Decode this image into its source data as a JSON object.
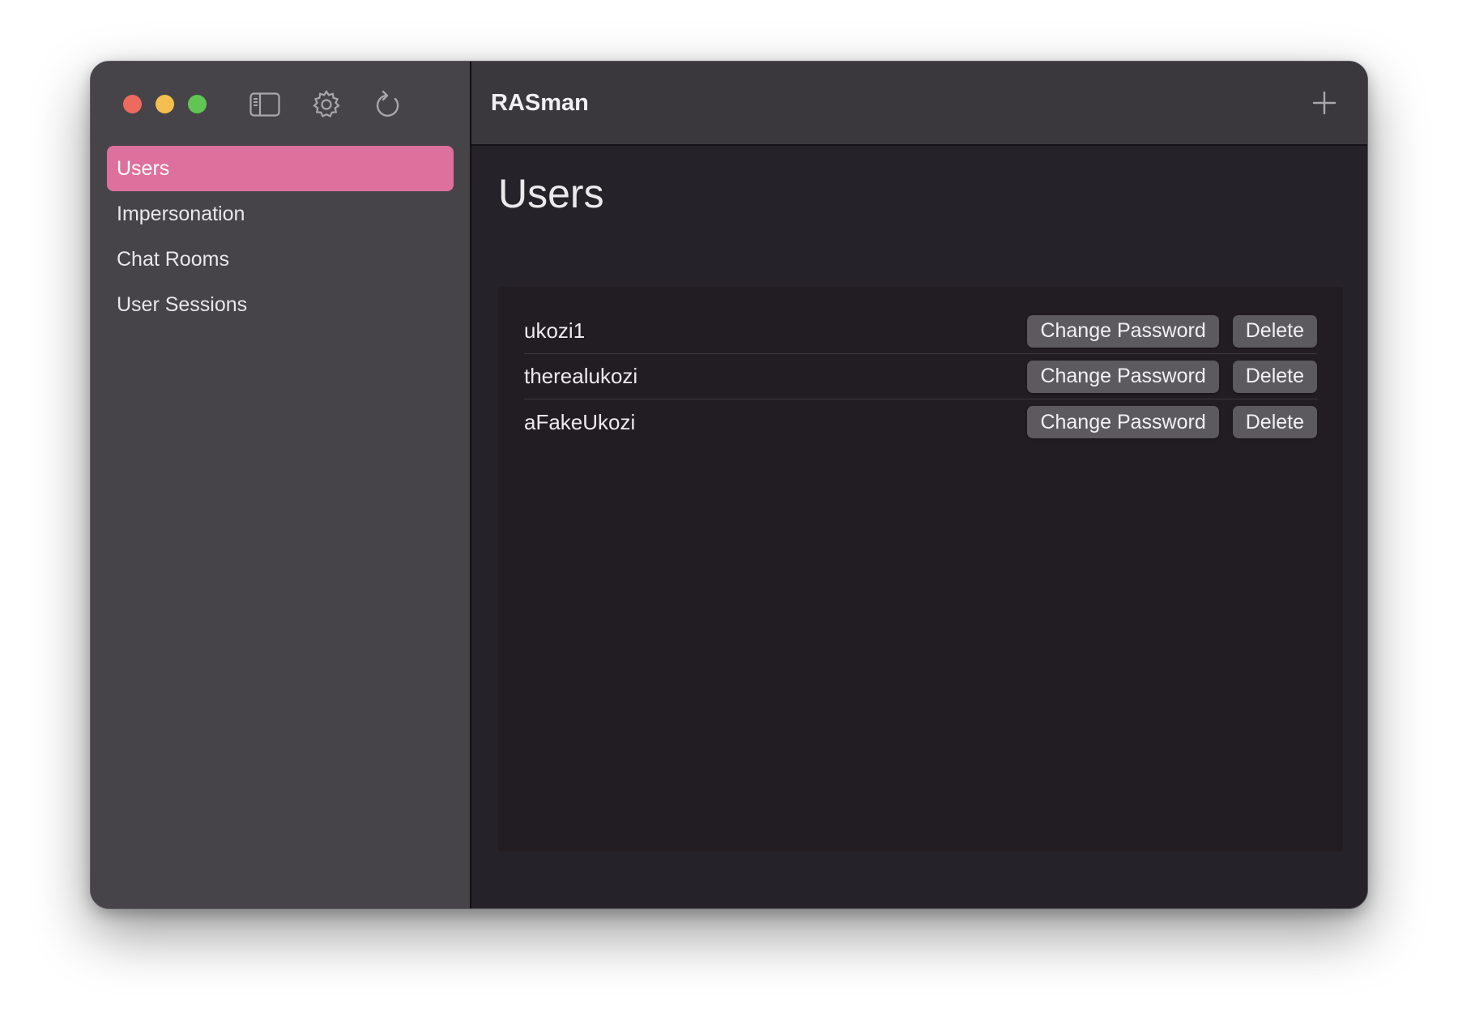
{
  "window": {
    "title": "RASman",
    "controls": [
      "close",
      "minimize",
      "maximize"
    ]
  },
  "toolbar": {
    "icons": [
      "sidebar-toggle-icon",
      "gear-icon",
      "refresh-icon"
    ],
    "add_icon": "plus-icon"
  },
  "sidebar": {
    "items": [
      {
        "label": "Users",
        "selected": true
      },
      {
        "label": "Impersonation",
        "selected": false
      },
      {
        "label": "Chat Rooms",
        "selected": false
      },
      {
        "label": "User Sessions",
        "selected": false
      }
    ]
  },
  "main": {
    "page_title": "Users",
    "users": [
      {
        "name": "ukozi1",
        "change_password_label": "Change Password",
        "delete_label": "Delete"
      },
      {
        "name": "therealukozi",
        "change_password_label": "Change Password",
        "delete_label": "Delete"
      },
      {
        "name": "aFakeUkozi",
        "change_password_label": "Change Password",
        "delete_label": "Delete"
      }
    ]
  },
  "colors": {
    "accent": "#de709d",
    "sidebar_bg": "#464448",
    "content_bg": "#262229",
    "list_bg": "#211d22",
    "button_bg": "#5d5a5f"
  }
}
